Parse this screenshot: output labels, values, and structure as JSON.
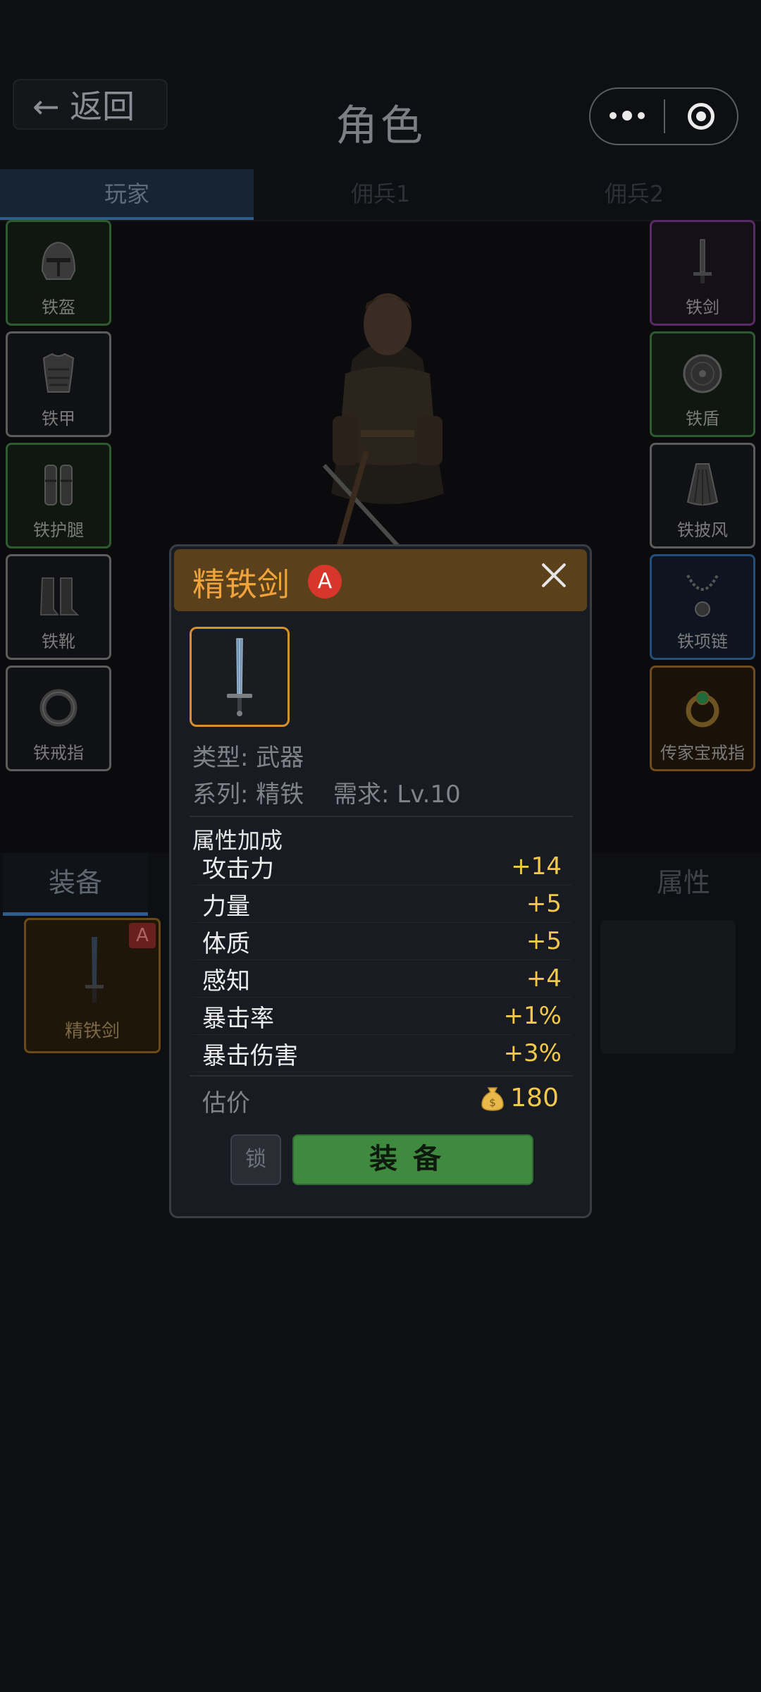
{
  "header": {
    "back_label": "← 返回",
    "title": "角色",
    "more_icon": "more-dots-icon",
    "target_icon": "target-icon"
  },
  "tabs": [
    {
      "label": "玩家",
      "active": true
    },
    {
      "label": "佣兵1",
      "active": false
    },
    {
      "label": "佣兵2",
      "active": false
    }
  ],
  "slots_left": [
    {
      "label": "铁盔",
      "icon": "helmet-icon",
      "rarity": "green"
    },
    {
      "label": "铁甲",
      "icon": "armor-icon",
      "rarity": "gray"
    },
    {
      "label": "铁护腿",
      "icon": "greaves-icon",
      "rarity": "green"
    },
    {
      "label": "铁靴",
      "icon": "boots-icon",
      "rarity": "gray"
    },
    {
      "label": "铁戒指",
      "icon": "ring-icon",
      "rarity": "gray"
    }
  ],
  "slots_right": [
    {
      "label": "铁剑",
      "icon": "sword-icon",
      "rarity": "purple"
    },
    {
      "label": "铁盾",
      "icon": "shield-icon",
      "rarity": "green"
    },
    {
      "label": "铁披风",
      "icon": "cloak-icon",
      "rarity": "gray"
    },
    {
      "label": "铁项链",
      "icon": "necklace-icon",
      "rarity": "blue"
    },
    {
      "label": "传家宝戒指",
      "icon": "gem-ring-icon",
      "rarity": "orange"
    }
  ],
  "lower": {
    "tab_equip": "装备",
    "tab_attr": "属性",
    "item": {
      "label": "精铁剑",
      "badge": "A"
    }
  },
  "modal": {
    "title": "精铁剑",
    "rank": "A",
    "type_line": "类型: 武器",
    "series_line": "系列: 精铁",
    "requirement_line": "需求: Lv.10",
    "section_label": "属性加成",
    "stats": [
      {
        "name": "攻击力",
        "value": "+14"
      },
      {
        "name": "力量",
        "value": "+5"
      },
      {
        "name": "体质",
        "value": "+5"
      },
      {
        "name": "感知",
        "value": "+4"
      },
      {
        "name": "暴击率",
        "value": "+1%"
      },
      {
        "name": "暴击伤害",
        "value": "+3%"
      }
    ],
    "price_label": "估价",
    "price_value": "180",
    "price_icon": "money-bag-icon",
    "lock_label": "锁",
    "equip_label": "装备"
  },
  "colors": {
    "accent_orange": "#f0a33a",
    "stat_yellow": "#f2c84b",
    "equip_green": "#3f8a3f",
    "rank_red": "#d8352b"
  }
}
